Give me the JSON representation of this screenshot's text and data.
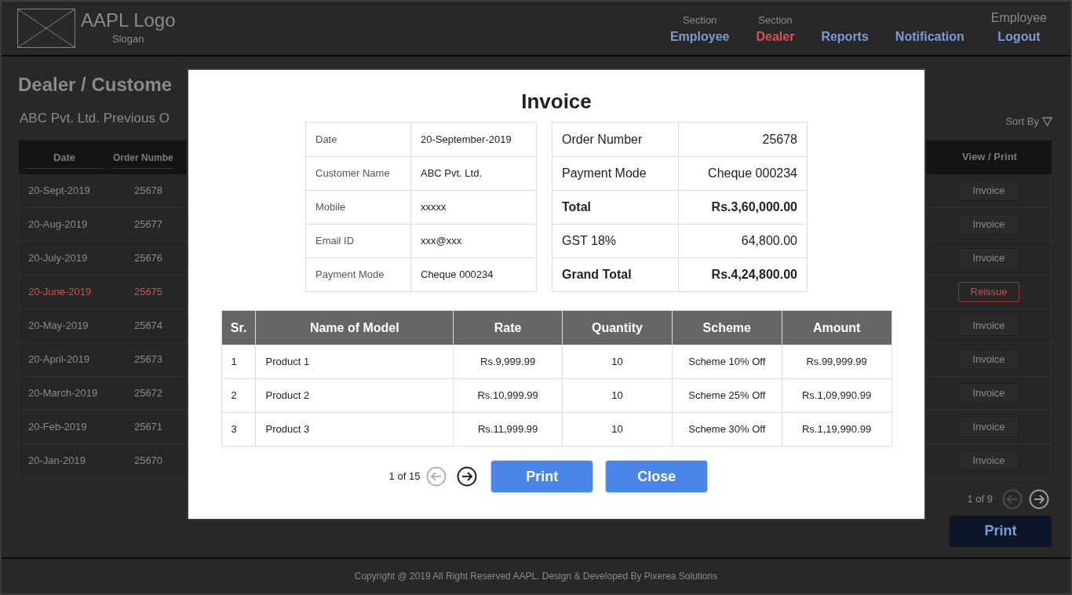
{
  "header": {
    "logo_text": "AAPL Logo",
    "slogan": "Slogan",
    "nav": [
      {
        "caption": "Section",
        "label": "Employee",
        "selected": false
      },
      {
        "caption": "Section",
        "label": "Dealer",
        "selected": true
      },
      {
        "label": "Reports",
        "selected": false
      },
      {
        "label": "Notification",
        "selected": false
      },
      {
        "caption": "Employee",
        "label": "Logout",
        "selected": false
      }
    ]
  },
  "page": {
    "title": "Dealer / Custome",
    "subtitle": "ABC Pvt. Ltd. Previous O",
    "sort_label": "Sort By",
    "table": {
      "columns": [
        "Date",
        "Order Numbe",
        "View / Print"
      ],
      "rows": [
        {
          "date": "20-Sept-2019",
          "order": "25678",
          "action": "Invoice",
          "flagged": false
        },
        {
          "date": "20-Aug-2019",
          "order": "25677",
          "action": "Invoice",
          "flagged": false
        },
        {
          "date": "20-July-2019",
          "order": "25676",
          "action": "Invoice",
          "flagged": false
        },
        {
          "date": "20-June-2019",
          "order": "25675",
          "action": "Reissue",
          "flagged": true
        },
        {
          "date": "20-May-2019",
          "order": "25674",
          "action": "Invoice",
          "flagged": false
        },
        {
          "date": "20-April-2019",
          "order": "25673",
          "action": "Invoice",
          "flagged": false
        },
        {
          "date": "20-March-2019",
          "order": "25672",
          "action": "Invoice",
          "flagged": false
        },
        {
          "date": "20-Feb-2019",
          "order": "25671",
          "action": "Invoice",
          "flagged": false
        },
        {
          "date": "20-Jan-2019",
          "order": "25670",
          "action": "Invoice",
          "flagged": false
        }
      ]
    },
    "pager": {
      "label": "1 of 9",
      "prev_disabled": true,
      "next_disabled": false
    },
    "print_button": "Print"
  },
  "footer": "Copyright @ 2019 All Right Reserved AAPL. Design & Developed By Pixerea Solutions",
  "dialog": {
    "title": "Invoice",
    "customer_info": [
      {
        "label": "Date",
        "value": "20-September-2019"
      },
      {
        "label": "Customer Name",
        "value": "ABC Pvt. Ltd."
      },
      {
        "label": "Mobile",
        "value": "xxxxx"
      },
      {
        "label": "Email ID",
        "value": "xxx@xxx"
      },
      {
        "label": "Payment Mode",
        "value": "Cheque 000234"
      }
    ],
    "order_info": [
      {
        "label": "Order Number",
        "value": "25678",
        "bold": false
      },
      {
        "label": "Payment Mode",
        "value": "Cheque 000234",
        "bold": false
      },
      {
        "label": "Total",
        "value": "Rs.3,60,000.00",
        "bold": true
      },
      {
        "label": "GST 18%",
        "value": "64,800.00",
        "bold": false
      },
      {
        "label": "Grand Total",
        "value": "Rs.4,24,800.00",
        "bold": true
      }
    ],
    "items": {
      "columns": [
        "Sr.",
        "Name of Model",
        "Rate",
        "Quantity",
        "Scheme",
        "Amount"
      ],
      "rows": [
        [
          "1",
          "Product 1",
          "Rs.9,999.99",
          "10",
          "Scheme 10% Off",
          "Rs.99,999.99"
        ],
        [
          "2",
          "Product 2",
          "Rs.10,999.99",
          "10",
          "Scheme 25% Off",
          "Rs.1,09,990.99"
        ],
        [
          "3",
          "Product 3",
          "Rs.11,999.99",
          "10",
          "Scheme 30% Off",
          "Rs.1,19,990.99"
        ]
      ]
    },
    "pager": {
      "label": "1 of 15",
      "prev_disabled": true,
      "next_disabled": false
    },
    "buttons": [
      "Print",
      "Close"
    ]
  }
}
